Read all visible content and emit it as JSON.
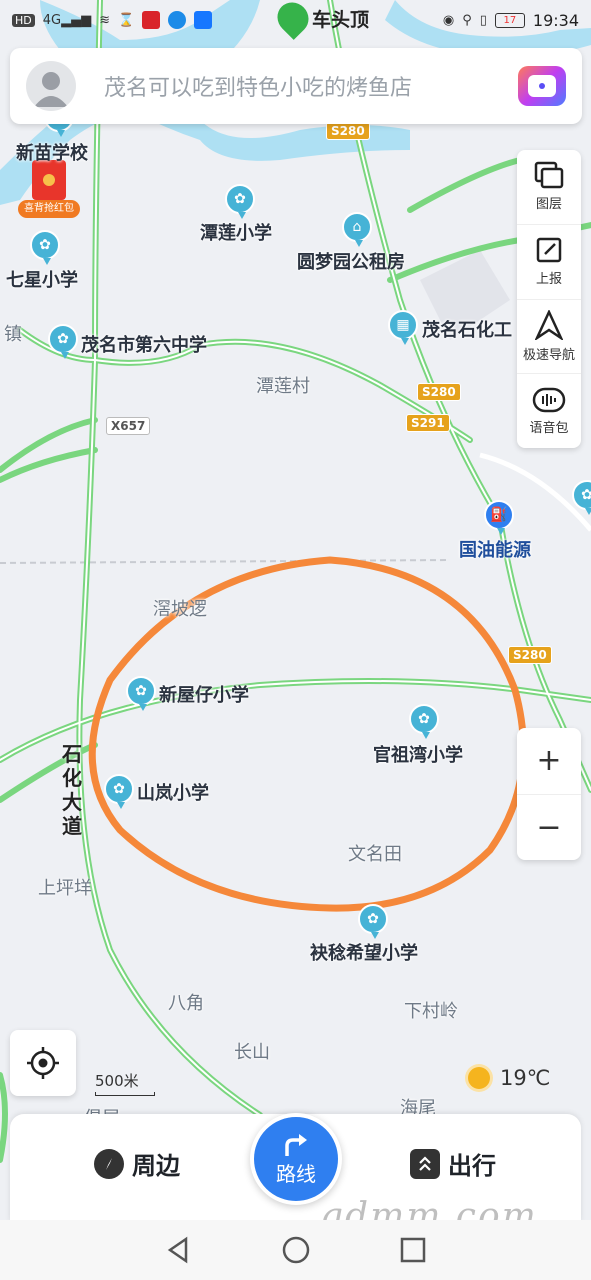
{
  "status_bar": {
    "left_icons": [
      "hd-icon",
      "signal-4g-icon",
      "wifi-icon",
      "hourglass-icon",
      "mic-app-icon",
      "browser-app-icon",
      "alipay-icon"
    ],
    "network_label": "HD",
    "signal_label": "4G",
    "location_title": "车头顶",
    "battery": "17",
    "time": "19:34"
  },
  "search": {
    "placeholder": "茂名可以吃到特色小吃的烤鱼店"
  },
  "toolbar": {
    "layers": "图层",
    "report": "上报",
    "fast_nav": "极速导航",
    "voice_pack": "语音包"
  },
  "zoom": {
    "in": "+",
    "out": "−"
  },
  "scale": "500米",
  "weather": {
    "temp": "19℃"
  },
  "bottom_nav": {
    "nearby": "周边",
    "route": "路线",
    "travel": "出行"
  },
  "watermark": "gdmm.com",
  "map": {
    "places": [
      {
        "name": "新苗学校",
        "kind": "poi"
      },
      {
        "name": "潭莲小学",
        "kind": "poi"
      },
      {
        "name": "圆梦园公租房",
        "kind": "poi"
      },
      {
        "name": "七星小学",
        "kind": "poi"
      },
      {
        "name": "茂名市第六中学",
        "kind": "poi"
      },
      {
        "name": "茂名石化工",
        "kind": "poi"
      },
      {
        "name": "潭莲村",
        "kind": "area"
      },
      {
        "name": "国油能源",
        "kind": "poi"
      },
      {
        "name": "滘坡逻",
        "kind": "area"
      },
      {
        "name": "新屋仔小学",
        "kind": "poi"
      },
      {
        "name": "官祖湾小学",
        "kind": "poi"
      },
      {
        "name": "山岚小学",
        "kind": "poi"
      },
      {
        "name": "文名田",
        "kind": "area"
      },
      {
        "name": "上坪垟",
        "kind": "area"
      },
      {
        "name": "袂稔希望小学",
        "kind": "poi"
      },
      {
        "name": "八角",
        "kind": "area"
      },
      {
        "name": "下村岭",
        "kind": "area"
      },
      {
        "name": "长山",
        "kind": "area"
      },
      {
        "name": "海尾",
        "kind": "area"
      },
      {
        "name": "镇",
        "kind": "area"
      },
      {
        "name": "倡屋",
        "kind": "area"
      }
    ],
    "roads": [
      "S280",
      "S280",
      "S291",
      "X657",
      "S280"
    ],
    "avenue": "石化大道",
    "red_packet": "喜背抢红包"
  },
  "colors": {
    "road_green": "#7ad67f",
    "river_blue": "#aee0f3",
    "circle_orange": "#f5883a",
    "route_blue": "#2f7ff0"
  }
}
